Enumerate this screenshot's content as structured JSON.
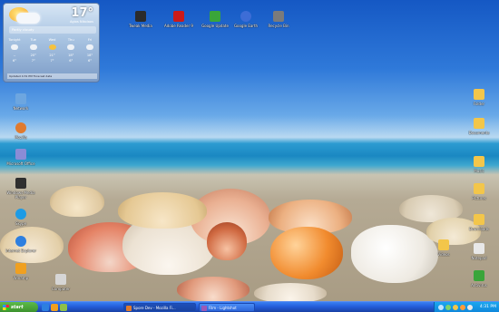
{
  "weather": {
    "temperature": "17°",
    "location": "Agios Nikolaos",
    "description": "Partly cloudy",
    "days": [
      {
        "name": "Tonight",
        "hi": "--",
        "lo": "6°",
        "icon": "cloud-icon"
      },
      {
        "name": "Tue",
        "hi": "20°",
        "lo": "7°",
        "icon": "cloud-icon"
      },
      {
        "name": "Wed",
        "hi": "21°",
        "lo": "7°",
        "icon": "sun-icon"
      },
      {
        "name": "Thu",
        "hi": "18°",
        "lo": "6°",
        "icon": "cloud-icon"
      },
      {
        "name": "Fri",
        "hi": "18°",
        "lo": "6°",
        "icon": "cloud-icon"
      }
    ],
    "footer": "Updated 4:31 PM  Forecast data"
  },
  "desktop": {
    "top_icons": [
      {
        "label": "Tweak Media",
        "icon": "app-icon",
        "color": "#2b2b2b"
      },
      {
        "label": "Adobe Reader 9",
        "icon": "pdf-icon",
        "color": "#cc1a1a"
      },
      {
        "label": "Google Update",
        "icon": "update-icon",
        "color": "#3aa53a"
      },
      {
        "label": "Google Earth",
        "icon": "globe-icon",
        "color": "#3d6dd6"
      },
      {
        "label": "Recycle Bin",
        "icon": "recycle-bin-icon",
        "color": "#7b7b7b"
      }
    ],
    "left_icons": [
      {
        "label": "Network",
        "icon": "network-icon",
        "color": "#6da6e0"
      },
      {
        "label": "Mozilla",
        "icon": "browser-icon",
        "color": "#e07a2e"
      },
      {
        "label": "Microsoft Office",
        "icon": "office-icon",
        "color": "#8a8cd6"
      },
      {
        "label": "Windows Media Player",
        "icon": "media-icon",
        "color": "#2f2f2f"
      },
      {
        "label": "Skype",
        "icon": "skype-icon",
        "color": "#1d9be6"
      },
      {
        "label": "Internet Explorer",
        "icon": "ie-icon",
        "color": "#2d7fe0"
      },
      {
        "label": "Winamp",
        "icon": "winamp-icon",
        "color": "#f0a020"
      },
      {
        "label": "Computer",
        "icon": "computer-icon",
        "color": "#d6d6d6"
      }
    ],
    "right_icons": [
      {
        "label": "Folder",
        "icon": "folder-icon",
        "color": "#f3c64a"
      },
      {
        "label": "Documents",
        "icon": "folder-icon",
        "color": "#f3c64a"
      },
      {
        "label": "Music",
        "icon": "folder-icon",
        "color": "#f3c64a"
      },
      {
        "label": "Pictures",
        "icon": "folder-icon",
        "color": "#f3c64a"
      },
      {
        "label": "Downloads",
        "icon": "folder-icon",
        "color": "#f3c64a"
      },
      {
        "label": "Videos",
        "icon": "folder-icon",
        "color": "#f3c64a"
      },
      {
        "label": "Notepad",
        "icon": "notepad-icon",
        "color": "#e8e8e8"
      },
      {
        "label": "Antivirus",
        "icon": "shield-icon",
        "color": "#3aa53a"
      }
    ]
  },
  "taskbar": {
    "start_label": "start",
    "quick_launch": [
      {
        "icon": "ie-icon",
        "color": "#2d7fe0"
      },
      {
        "icon": "media-icon",
        "color": "#f0a020"
      },
      {
        "icon": "desktop-icon",
        "color": "#8fc04a"
      }
    ],
    "tasks": [
      {
        "label": "Spore Dev - Mozilla Fi...",
        "icon": "browser-icon",
        "color": "#e07a2e",
        "active": true
      },
      {
        "label": "Film - Lightshot",
        "icon": "app-icon",
        "color": "#9b59b6",
        "active": false
      }
    ],
    "tray_icons": [
      "volume-icon",
      "network-icon",
      "security-icon",
      "update-icon",
      "battery-icon"
    ],
    "clock": "4:31 PM"
  }
}
